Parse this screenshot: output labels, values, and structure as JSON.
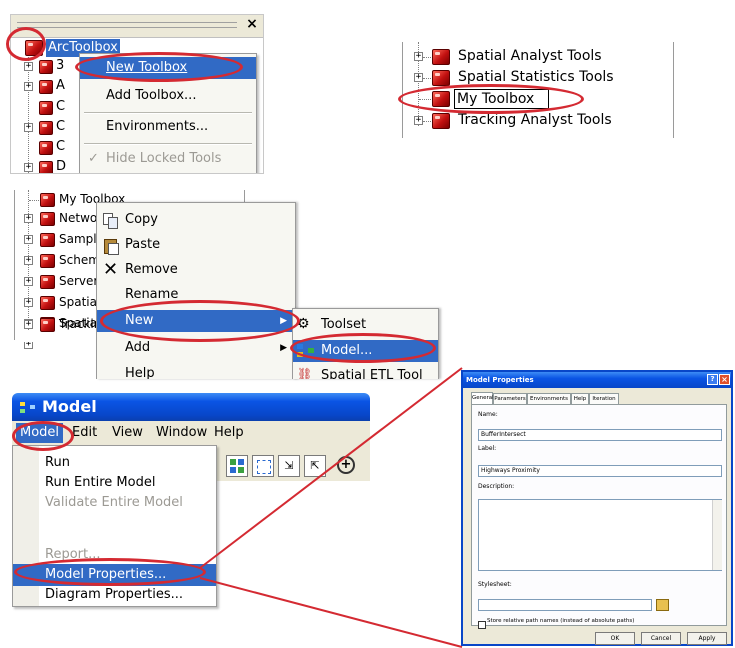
{
  "panel1": {
    "root_label": "ArcToolbox",
    "close_glyph": "×",
    "child_initials": [
      "3",
      "A",
      "C",
      "C",
      "C",
      "D"
    ],
    "menu": [
      {
        "label": "New Toolbox",
        "selected": true
      },
      {
        "label": "Add Toolbox...",
        "selected": false
      },
      {
        "label": "Environments...",
        "selected": false
      },
      {
        "label": "Hide Locked Tools",
        "selected": false,
        "disabled": true,
        "checked": true
      }
    ]
  },
  "panel2": {
    "items": [
      "Spatial Analyst Tools",
      "Spatial Statistics Tools",
      "My Toolbox",
      "Tracking Analyst Tools"
    ],
    "editing_index": 2
  },
  "panel3": {
    "tree": [
      "My Toolbox",
      "Netwo",
      "Sample",
      "Schem",
      "Server",
      "Spatial",
      "Spatial",
      "Trackin"
    ],
    "menu": [
      {
        "label": "Copy",
        "icon": "copy-icon"
      },
      {
        "label": "Paste",
        "icon": "paste-icon"
      },
      {
        "label": "Remove",
        "icon": "remove-icon"
      },
      {
        "label": "Rename",
        "icon": ""
      },
      {
        "label": "New",
        "icon": "",
        "selected": true,
        "submenu": true
      },
      {
        "label": "Add",
        "icon": "",
        "submenu": true
      },
      {
        "label": "Help",
        "icon": ""
      }
    ],
    "submenu": [
      {
        "label": "Toolset",
        "icon": "toolset-icon"
      },
      {
        "label": "Model...",
        "icon": "model-icon",
        "selected": true
      },
      {
        "label": "Spatial ETL Tool",
        "icon": "etl-icon"
      }
    ]
  },
  "panel4": {
    "window_title": "Model",
    "menubar": [
      "Model",
      "Edit",
      "View",
      "Window",
      "Help"
    ],
    "menu": [
      {
        "label": "Run",
        "disabled": false
      },
      {
        "label": "Run Entire Model",
        "disabled": false
      },
      {
        "label": "Validate Entire Model",
        "disabled": true
      },
      {
        "label": "Report...",
        "disabled": true
      },
      {
        "label": "Model Properties...",
        "disabled": false,
        "selected": true
      },
      {
        "label": "Diagram Properties...",
        "disabled": false
      }
    ]
  },
  "dialog": {
    "title": "Model Properties",
    "tabs": [
      "General",
      "Parameters",
      "Environments",
      "Help",
      "Iteration"
    ],
    "name_label": "Name:",
    "name_value": "BufferIntersect",
    "label_label": "Label:",
    "label_value": "Highways Proximity",
    "description_label": "Description:",
    "stylesheet_label": "Stylesheet:",
    "checkbox_label": "Store relative path names (instead of absolute paths)",
    "buttons": [
      "OK",
      "Cancel",
      "Apply"
    ]
  },
  "colors": {
    "highlight": "#d42a32",
    "selection": "#316ac5",
    "xp_title": "#0a54e4"
  }
}
